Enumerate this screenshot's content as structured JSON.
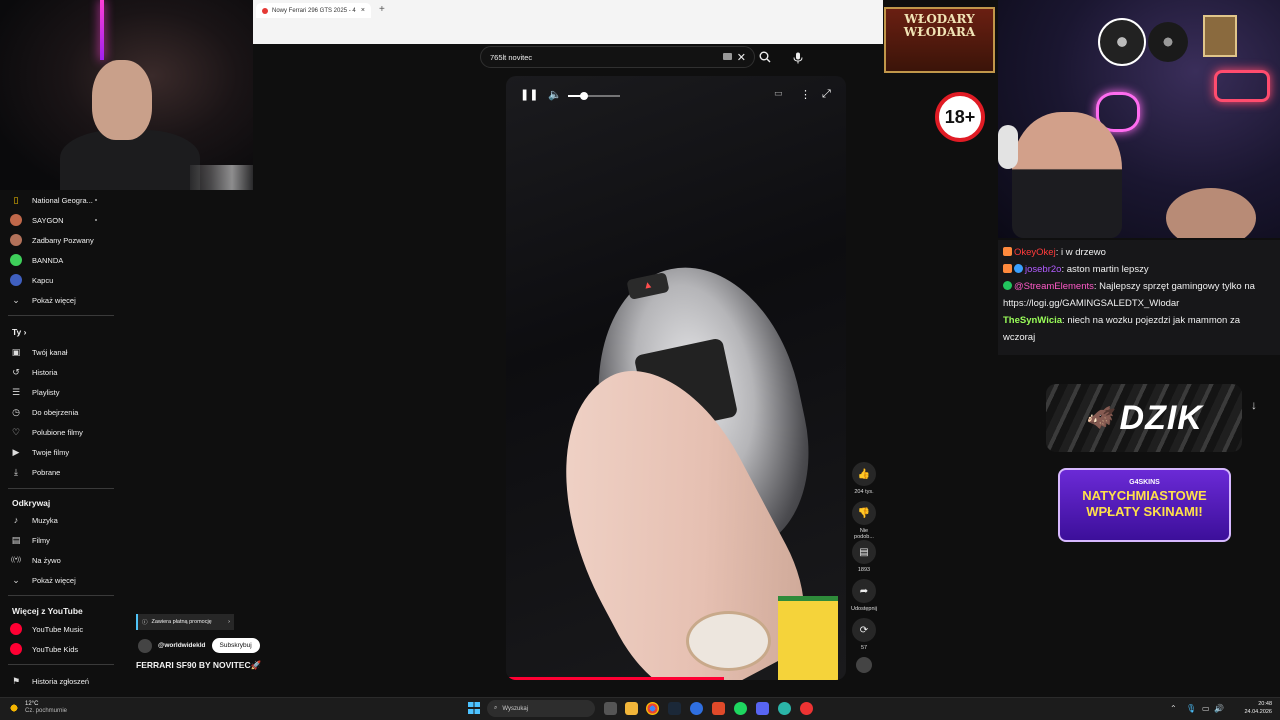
{
  "browser": {
    "tab_title": "Nowy Ferrari 296 GTS 2025 - 4",
    "tab_close": "×",
    "new_tab": "+"
  },
  "search": {
    "query": "765lt novitec",
    "clear": "✕",
    "search_icon": "search-icon",
    "mic_icon": "microphone-icon"
  },
  "sidebar": {
    "subscriptions": [
      {
        "label": "National Geogra...",
        "icon": "natgeo-avatar",
        "color": "#f6c300",
        "dot": true
      },
      {
        "label": "SAYGON",
        "icon": "saygon-avatar",
        "color": "#c0684a",
        "dot": true
      },
      {
        "label": "Zadbany Pozwany",
        "icon": "zadbany-avatar",
        "color": "#b3725a",
        "dot": false
      },
      {
        "label": "BANNDA",
        "icon": "bannda-avatar",
        "color": "#3ecf5a",
        "dot": false
      },
      {
        "label": "Kapcu",
        "icon": "kapcu-avatar",
        "color": "#3f5fbf",
        "dot": false
      }
    ],
    "show_more_1": "Pokaż więcej",
    "you_heading": "Ty",
    "you_items": [
      {
        "label": "Twój kanał",
        "icon": "channel-icon",
        "glyph": "▣"
      },
      {
        "label": "Historia",
        "icon": "history-icon",
        "glyph": "↺"
      },
      {
        "label": "Playlisty",
        "icon": "playlist-icon",
        "glyph": "☰"
      },
      {
        "label": "Do obejrzenia",
        "icon": "clock-icon",
        "glyph": "◷"
      },
      {
        "label": "Polubione filmy",
        "icon": "thumb-up-icon",
        "glyph": "👍"
      },
      {
        "label": "Twoje filmy",
        "icon": "video-icon",
        "glyph": "▶"
      },
      {
        "label": "Pobrane",
        "icon": "download-icon",
        "glyph": "⤓"
      }
    ],
    "explore_heading": "Odkrywaj",
    "explore_items": [
      {
        "label": "Muzyka",
        "icon": "music-icon",
        "glyph": "♪"
      },
      {
        "label": "Filmy",
        "icon": "film-icon",
        "glyph": "▤"
      },
      {
        "label": "Na żywo",
        "icon": "live-icon",
        "glyph": "((•))"
      }
    ],
    "show_more_2": "Pokaż więcej",
    "more_heading": "Więcej z YouTube",
    "more_items": [
      {
        "label": "YouTube Music",
        "icon": "youtube-music-icon",
        "color": "#ff0033"
      },
      {
        "label": "YouTube Kids",
        "icon": "youtube-kids-icon",
        "color": "#ff0033"
      }
    ],
    "report_history": "Historia zgłoszeń"
  },
  "video": {
    "progress": 0.64,
    "volume": 0.3,
    "promo": "Zawiera płatną promocję",
    "channel": "@worldwidekld",
    "subscribe": "Subskrybuj",
    "title": "FERRARI SF90 BY NOVITEC🚀",
    "accent": "#ff0033"
  },
  "actions": {
    "likes": "204 tys.",
    "dislike": "Nie podob...",
    "comments": "1893",
    "share": "Udostępnij",
    "remix": "57"
  },
  "overlays": {
    "wlodary_line1": "WŁODARY",
    "wlodary_line2": "WŁODARA",
    "age": "18+",
    "dzik": "DZIK",
    "skins_brand": "G4SKINS",
    "skins_line1": "NATYCHMIASTOWE",
    "skins_line2": "WPŁATY SKINAMI!"
  },
  "chat": [
    {
      "user": "OkeyOkej",
      "user_color": "#ff3b3b",
      "badge_color": "#ff8a3d",
      "text": ": i w drzewo"
    },
    {
      "user": "josebr2o",
      "user_color": "#b15cff",
      "badge_color": "#3aa0ff",
      "text": ": aston martin lepszy"
    },
    {
      "user": "@StreamElements",
      "user_color": "#ff5ac8",
      "badge_color": "#22c55e",
      "text": ": Najlepszy sprzęt gamingowy tylko na https://logi.gg/GAMINGSALEDTX_Wlodar"
    },
    {
      "user": "TheSynWicia",
      "user_color": "#9bff5a",
      "badge_color": "",
      "text": ": niech na wozku pojezdzi jak mammon za wczoraj"
    }
  ],
  "taskbar": {
    "temp": "12°C",
    "weather": "Cz. pochmurnie",
    "search_placeholder": "Wyszukaj",
    "time": "20:48",
    "date": "24.04.2026"
  }
}
